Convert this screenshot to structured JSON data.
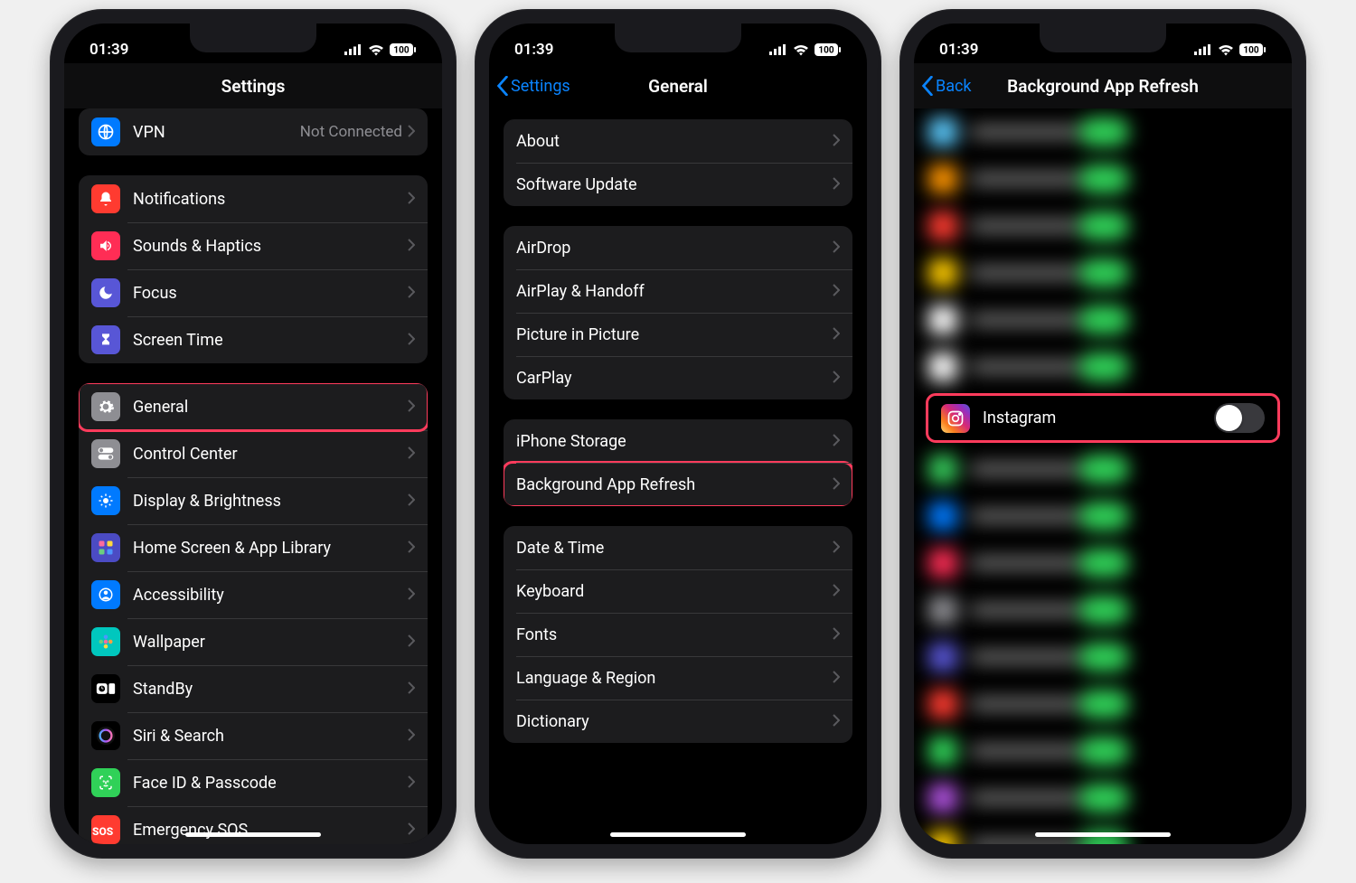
{
  "status": {
    "time": "01:39",
    "battery": "100"
  },
  "screen1": {
    "title": "Settings",
    "vpn": {
      "label": "VPN",
      "value": "Not Connected"
    },
    "group1": [
      {
        "label": "Notifications",
        "icon": "bell",
        "color": "#ff3b30"
      },
      {
        "label": "Sounds & Haptics",
        "icon": "speaker",
        "color": "#ff2d55"
      },
      {
        "label": "Focus",
        "icon": "moon",
        "color": "#5856d6"
      },
      {
        "label": "Screen Time",
        "icon": "hourglass",
        "color": "#5856d6"
      }
    ],
    "group2": [
      {
        "label": "General",
        "icon": "gear",
        "color": "#8e8e93",
        "highlight": true
      },
      {
        "label": "Control Center",
        "icon": "switches",
        "color": "#8e8e93"
      },
      {
        "label": "Display & Brightness",
        "icon": "sun",
        "color": "#007aff"
      },
      {
        "label": "Home Screen & App Library",
        "icon": "apps",
        "color": "#4b4bc4"
      },
      {
        "label": "Accessibility",
        "icon": "person",
        "color": "#007aff"
      },
      {
        "label": "Wallpaper",
        "icon": "flower",
        "color": "#00c7be"
      },
      {
        "label": "StandBy",
        "icon": "standby",
        "color": "#000"
      },
      {
        "label": "Siri & Search",
        "icon": "siri",
        "color": "#000"
      },
      {
        "label": "Face ID & Passcode",
        "icon": "face",
        "color": "#30d158"
      },
      {
        "label": "Emergency SOS",
        "icon": "sos",
        "color": "#ff3b30"
      }
    ]
  },
  "screen2": {
    "back": "Settings",
    "title": "General",
    "group1": [
      {
        "label": "About"
      },
      {
        "label": "Software Update"
      }
    ],
    "group2": [
      {
        "label": "AirDrop"
      },
      {
        "label": "AirPlay & Handoff"
      },
      {
        "label": "Picture in Picture"
      },
      {
        "label": "CarPlay"
      }
    ],
    "group3": [
      {
        "label": "iPhone Storage"
      },
      {
        "label": "Background App Refresh",
        "highlight": true
      }
    ],
    "group4": [
      {
        "label": "Date & Time"
      },
      {
        "label": "Keyboard"
      },
      {
        "label": "Fonts"
      },
      {
        "label": "Language & Region"
      },
      {
        "label": "Dictionary"
      }
    ]
  },
  "screen3": {
    "back": "Back",
    "title": "Background App Refresh",
    "app": {
      "label": "Instagram",
      "enabled": false
    }
  }
}
